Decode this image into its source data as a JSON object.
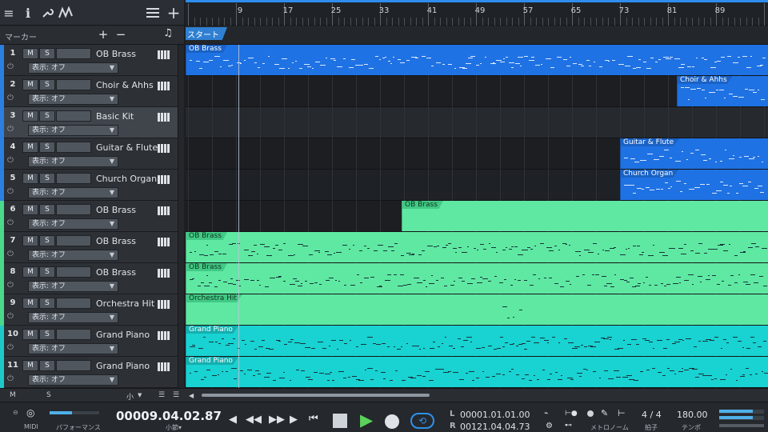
{
  "toolbar": {
    "icons": [
      "menu-icon",
      "info-icon",
      "wrench-icon",
      "automation-icon",
      "list-icon",
      "add-icon"
    ]
  },
  "marker": {
    "label": "マーカー",
    "add": "+",
    "remove": "−",
    "music_icon": "♫",
    "start": "スタート"
  },
  "ruler": {
    "bars": [
      "9",
      "17",
      "25",
      "33",
      "41",
      "49",
      "57",
      "65",
      "73",
      "81",
      "89"
    ]
  },
  "tracks": [
    {
      "num": "1",
      "name": "OB Brass",
      "m": "M",
      "s": "S",
      "view": "表示: オフ",
      "color": "#2b7fe0"
    },
    {
      "num": "2",
      "name": "Choir & Ahhs",
      "m": "M",
      "s": "S",
      "view": "表示: オフ",
      "color": "#2b7fe0"
    },
    {
      "num": "3",
      "name": "Basic Kit",
      "m": "M",
      "s": "S",
      "view": "表示: オフ",
      "color": "#2b7fe0"
    },
    {
      "num": "4",
      "name": "Guitar & Flute",
      "m": "M",
      "s": "S",
      "view": "表示: オフ",
      "color": "#2b7fe0"
    },
    {
      "num": "5",
      "name": "Church Organ",
      "m": "M",
      "s": "S",
      "view": "表示: オフ",
      "color": "#2b7fe0"
    },
    {
      "num": "6",
      "name": "OB Brass",
      "m": "M",
      "s": "S",
      "view": "表示: オフ",
      "color": "#4ad88a"
    },
    {
      "num": "7",
      "name": "OB Brass",
      "m": "M",
      "s": "S",
      "view": "表示: オフ",
      "color": "#4ad88a"
    },
    {
      "num": "8",
      "name": "OB Brass",
      "m": "M",
      "s": "S",
      "view": "表示: オフ",
      "color": "#4ad88a"
    },
    {
      "num": "9",
      "name": "Orchestra Hit",
      "m": "M",
      "s": "S",
      "view": "表示: オフ",
      "color": "#4ad88a"
    },
    {
      "num": "10",
      "name": "Grand Piano",
      "m": "M",
      "s": "S",
      "view": "表示: オフ",
      "color": "#1fc8c8"
    },
    {
      "num": "11",
      "name": "Grand Piano",
      "m": "M",
      "s": "S",
      "view": "表示: オフ",
      "color": "#1fc8c8"
    }
  ],
  "clips": [
    {
      "track": 0,
      "name": "OB Brass",
      "color": "#1f72e3",
      "tagBg": "#1a62c6",
      "tagColor": "#ffffff"
    },
    {
      "track": 1,
      "name": "Choir & Ahhs",
      "color": "#1f72e3",
      "tagBg": "#1a62c6",
      "tagColor": "#ffffff"
    },
    {
      "track": 3,
      "name": "Guitar & Flute",
      "color": "#1f72e3",
      "tagBg": "#1a62c6",
      "tagColor": "#ffffff"
    },
    {
      "track": 4,
      "name": "Church Organ",
      "color": "#1f72e3",
      "tagBg": "#1a62c6",
      "tagColor": "#ffffff"
    },
    {
      "track": 5,
      "name": "OB Brass",
      "color": "#5fe8a2",
      "tagBg": "#41c985",
      "tagColor": "#10331f"
    },
    {
      "track": 6,
      "name": "OB Brass",
      "color": "#5fe8a2",
      "tagBg": "#41c985",
      "tagColor": "#10331f"
    },
    {
      "track": 7,
      "name": "OB Brass",
      "color": "#5fe8a2",
      "tagBg": "#41c985",
      "tagColor": "#10331f"
    },
    {
      "track": 8,
      "name": "Orchestra Hit",
      "color": "#5fe8a2",
      "tagBg": "#41c985",
      "tagColor": "#10331f"
    },
    {
      "track": 9,
      "name": "Grand Piano",
      "color": "#19d2d2",
      "tagBg": "#14afaf",
      "tagColor": "#ffffff"
    },
    {
      "track": 10,
      "name": "Grand Piano",
      "color": "#19d2d2",
      "tagBg": "#14afaf",
      "tagColor": "#ffffff"
    }
  ],
  "bottom": {
    "m": "M",
    "s": "S",
    "zoom": "小",
    "menu": "☰",
    "scroll_left": "◀"
  },
  "transport": {
    "midi": "MIDI",
    "performance": "パフォーマンス",
    "time": "00009.04.02.87",
    "time_unit": "小節",
    "loop_l_label": "L",
    "loop_l": "00001.01.01.00",
    "loop_r_label": "R",
    "loop_r": "00121.04.04.73",
    "metronome": "メトロノーム",
    "time_sig": "4 / 4",
    "time_sig_label": "拍子",
    "tempo": "180.00",
    "tempo_label": "テンポ",
    "performance_level": 0.45,
    "output_level": 0.75
  }
}
